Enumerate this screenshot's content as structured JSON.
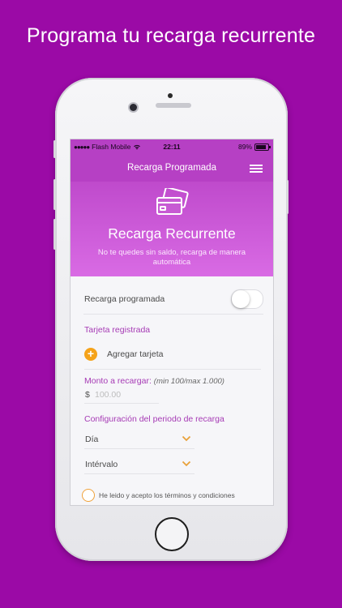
{
  "headline": "Programa tu recarga recurrente",
  "status_bar": {
    "signal_dots": "●●●●●",
    "carrier": "Flash Mobile",
    "time": "22:11",
    "battery_percent": "89%",
    "battery_level": 0.89
  },
  "nav": {
    "title": "Recarga Programada",
    "menu_icon": "hamburger-menu-icon"
  },
  "hero": {
    "icon": "credit-cards-icon",
    "title": "Recarga Recurrente",
    "subtitle": "No te quedes sin saldo, recarga de manera automática"
  },
  "form": {
    "scheduled_recharge_label": "Recarga programada",
    "scheduled_recharge_on": false,
    "registered_card_label": "Tarjeta registrada",
    "add_card_label": "Agregar tarjeta",
    "amount_label": "Monto a recargar:",
    "amount_hint": "(min 100/max 1.000)",
    "currency_symbol": "$",
    "amount_placeholder": "100.00",
    "period_config_label": "Configuración del periodo de recarga",
    "period_select_value": "Día",
    "interval_select_value": "Intérvalo",
    "terms_label": "He leido y acepto los términos y condiciones"
  },
  "colors": {
    "page_bg": "#9b0aa6",
    "accent_purple": "#b640c4",
    "accent_orange": "#f5a31a",
    "section_label": "#a63bb5"
  }
}
